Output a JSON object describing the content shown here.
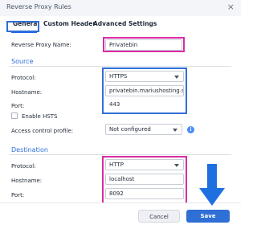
{
  "window": {
    "title": "Reverse Proxy Rules",
    "close": "×"
  },
  "tabs": [
    {
      "label": "General"
    },
    {
      "label": "Custom Header"
    },
    {
      "label": "Advanced Settings"
    }
  ],
  "general": {
    "rule_name_label": "Reverse Proxy Name:",
    "rule_name_value": "Privatebin"
  },
  "source": {
    "heading": "Source",
    "protocol_label": "Protocol:",
    "protocol_value": "HTTPS",
    "hostname_label": "Hostname:",
    "hostname_value": "privatebin.mariushosting.s",
    "port_label": "Port:",
    "port_value": "443",
    "hsts_label": "Enable HSTS",
    "acl_label": "Access control profile:",
    "acl_value": "Not configured",
    "info_icon": "i"
  },
  "destination": {
    "heading": "Destination",
    "protocol_label": "Protocol:",
    "protocol_value": "HTTP",
    "hostname_label": "Hostname:",
    "hostname_value": "localhost",
    "port_label": "Port:",
    "port_value": "8092"
  },
  "footer": {
    "cancel": "Cancel",
    "save": "Save"
  },
  "colors": {
    "accent": "#2f6fd6",
    "highlight_blue": "#2f6fd6",
    "highlight_pink": "#d92ca3",
    "arrow": "#1e6fe0"
  }
}
